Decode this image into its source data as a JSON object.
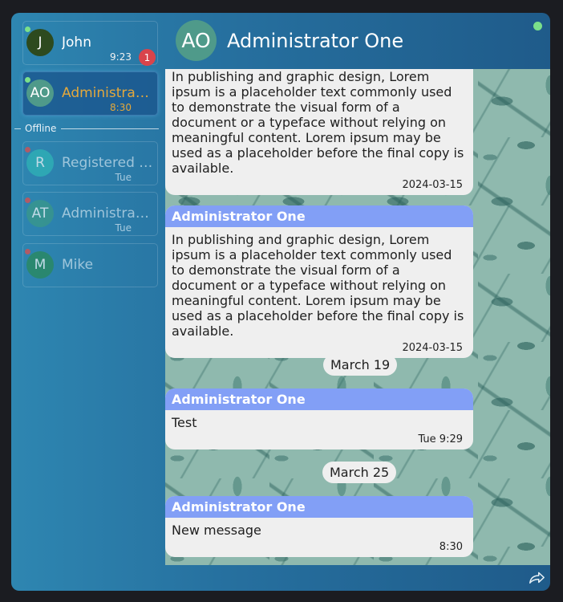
{
  "contacts": [
    {
      "initials": "J",
      "name": "John",
      "time": "9:23",
      "unread": "1",
      "avatar_color": "#2d4a1e",
      "status": "online"
    },
    {
      "initials": "AO",
      "name": "Administrator One",
      "time": "8:30",
      "avatar_color": "#4f9a8a",
      "status": "online"
    },
    {
      "initials": "R",
      "name": "Registered User",
      "time": "Tue",
      "avatar_color": "#2fb7b7",
      "status": "away"
    },
    {
      "initials": "AT",
      "name": "Administrator Two",
      "time": "Tue",
      "avatar_color": "#3a9a86",
      "status": "away"
    },
    {
      "initials": "M",
      "name": "Mike",
      "time": "",
      "avatar_color": "#2a8a55",
      "status": "away"
    }
  ],
  "divider": {
    "label": "Offline"
  },
  "header": {
    "initials": "AO",
    "title": "Administrator One"
  },
  "messages": [
    {
      "sender": "",
      "text": "In publishing and graphic design, Lorem ipsum is a placeholder text commonly used to demonstrate the visual form of a document or a typeface without relying on meaningful content. Lorem ipsum may be used as a placeholder before the final copy is available.",
      "time": "2024-03-15"
    },
    {
      "sender": "Administrator One",
      "text": "In publishing and graphic design, Lorem ipsum is a placeholder text commonly used to demonstrate the visual form of a document or a typeface without relying on meaningful content. Lorem ipsum may be used as a placeholder before the final copy is available.",
      "time": "2024-03-15"
    },
    {
      "sender": "Administrator One",
      "text": "Test",
      "time": "Tue 9:29"
    },
    {
      "sender": "Administrator One",
      "text": "New message",
      "time": "8:30"
    }
  ],
  "date_separators": [
    "March 19",
    "March 25"
  ],
  "colors": {
    "accent": "#e3a83c",
    "sender_bar": "#829ff6",
    "online": "#7be08a",
    "badge": "#d9444b"
  },
  "icons": {
    "share": "share-icon"
  }
}
